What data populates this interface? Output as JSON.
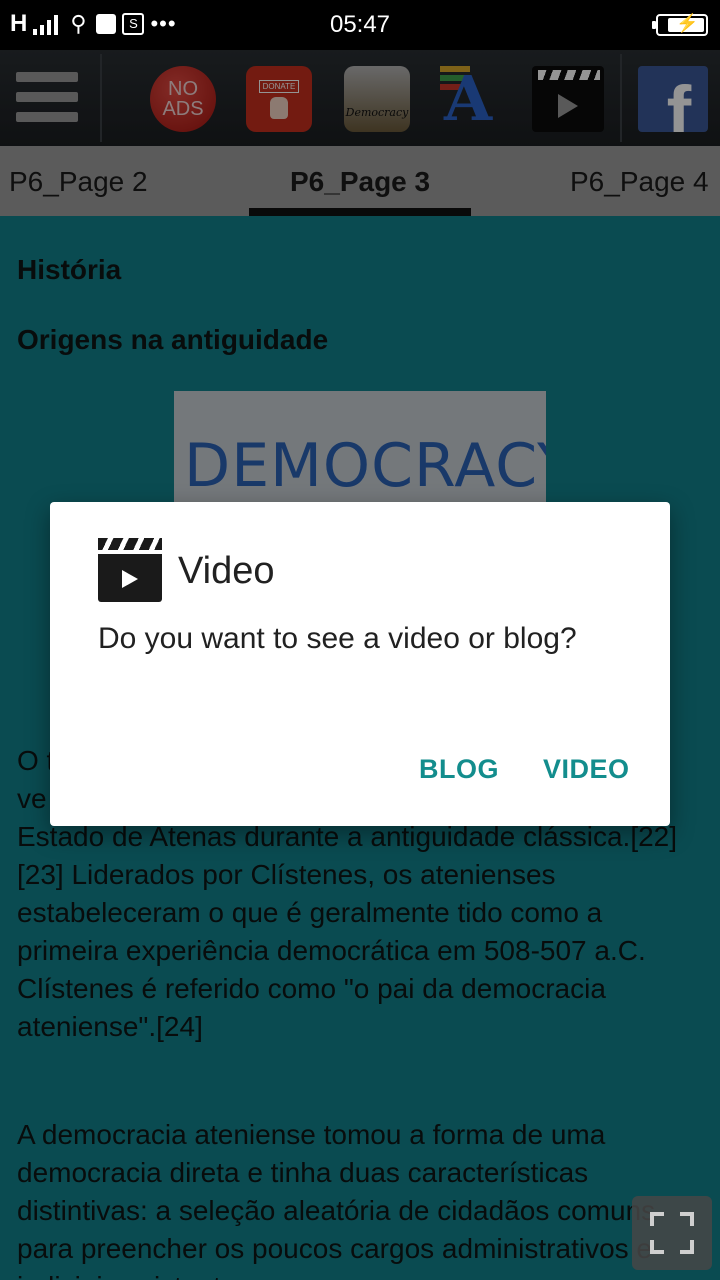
{
  "status_bar": {
    "network": "H",
    "sim_icon": "S",
    "dots": "•••",
    "time": "05:47",
    "battery_icon": "charging-battery-icon"
  },
  "toolbar": {
    "menu_icon": "hamburger-menu-icon",
    "no_ads_line1": "NO",
    "no_ads_line2": "ADS",
    "donate_label": "DONATE",
    "democracy_label": "Democracy",
    "font_icon_letter": "A",
    "video_icon": "clapperboard-icon",
    "facebook_letter": "f"
  },
  "tabs": [
    {
      "label": "P6_Page 2"
    },
    {
      "label": "P6_Page 3"
    },
    {
      "label": "P6_Page 4"
    }
  ],
  "content": {
    "heading1": "História",
    "heading2": "Origens na antiguidade",
    "image_word": "DEMOCRACY",
    "para1": "O t... ve... grego na cidade-Estado de Atenas durante a antiguidade clássica.[22][23] Liderados por Clístenes, os atenienses estabeleceram o que é geralmente tido como a primeira experiência democrática em 508-507 a.C. Clístenes é referido como \"o pai da democracia ateniense\".[24]",
    "para1_visible": "O t                                                   ve                                                   grego na cidade-Estado de Atenas durante a antiguidade clássica.[22][23] Liderados por Clístenes, os atenienses estabeleceram o que é geralmente tido como a primeira experiência democrática em 508-507 a.C. Clístenes é referido como \"o pai da democracia ateniense\".[24]",
    "para2": "A democracia ateniense tomou a forma de uma democracia direta e tinha duas características distintivas: a seleção aleatória de cidadãos comuns para preencher os poucos cargos administrativos e judiciais existentes"
  },
  "dialog": {
    "icon": "clapperboard-icon",
    "title": "Video",
    "message": "Do you want to see a video or blog?",
    "blog_button": "BLOG",
    "video_button": "VIDEO",
    "accent_color": "#138d8d"
  },
  "fullscreen_button": {
    "icon": "fullscreen-expand-icon"
  }
}
